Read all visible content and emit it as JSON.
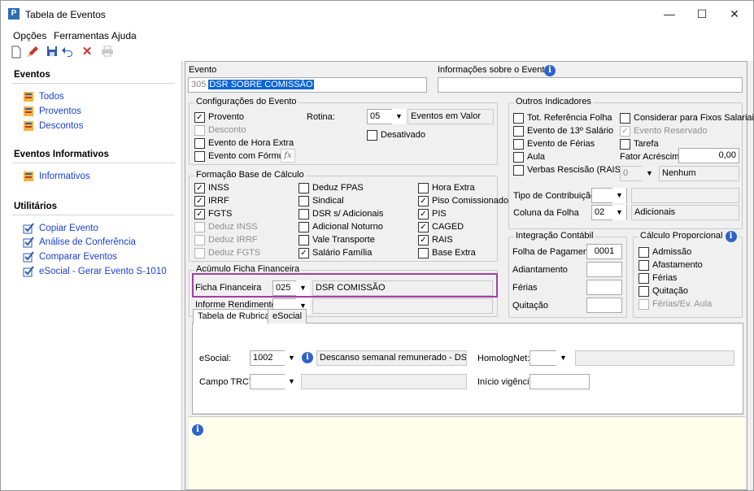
{
  "window": {
    "title": "Tabela de Eventos",
    "minimize": "—",
    "maximize": "☐",
    "close": "✕"
  },
  "menu": [
    "Opções",
    "Ferramentas",
    "Ajuda"
  ],
  "sidebar": {
    "eventos": {
      "heading": "Eventos",
      "items": [
        "Todos",
        "Proventos",
        "Descontos"
      ]
    },
    "informativos": {
      "heading": "Eventos Informativos",
      "items": [
        "Informativos"
      ]
    },
    "utilitarios": {
      "heading": "Utilitários",
      "items": [
        "Copiar Evento",
        "Análise de Conferência",
        "Comparar Eventos",
        "eSocial - Gerar Evento S-1010"
      ]
    }
  },
  "evento": {
    "label": "Evento",
    "code": "305",
    "name": "DSR SOBRE COMISSÃO",
    "info_label": "Informações sobre o Evento",
    "info_value": ""
  },
  "config": {
    "title": "Configurações do Evento",
    "provento": "Provento",
    "desconto": "Desconto",
    "hora_extra": "Evento de Hora Extra",
    "formula": "Evento com Fórmula",
    "rotina_label": "Rotina:",
    "rotina_value": "05",
    "rotina_desc": "Eventos em Valor",
    "desativado": "Desativado",
    "fx": "fx"
  },
  "base": {
    "title": "Formação Base de Cálculo",
    "col1": [
      "INSS",
      "IRRF",
      "FGTS",
      "Deduz INSS",
      "Deduz IRRF",
      "Deduz FGTS"
    ],
    "col2": [
      "Deduz FPAS",
      "Sindical",
      "DSR s/ Adicionais",
      "Adicional Noturno",
      "Vale Transporte",
      "Salário Família"
    ],
    "col3": [
      "Hora Extra",
      "Piso Comissionado",
      "PIS",
      "CAGED",
      "RAIS",
      "Base Extra"
    ]
  },
  "acumulo": {
    "title": "Acúmulo Ficha Financeira",
    "ficha_label": "Ficha Financeira",
    "ficha_code": "025",
    "ficha_desc": "DSR COMISSÃO",
    "informe_label": "Informe Rendimentos",
    "informe_value": ""
  },
  "outros": {
    "title": "Outros Indicadores",
    "left": [
      "Tot. Referência Folha",
      "Evento de 13º Salário",
      "Evento de Férias",
      "Aula",
      "Verbas Rescisão (RAIS)"
    ],
    "right": [
      "Considerar para Fixos Salariais",
      "Evento Reservado",
      "Tarefa"
    ],
    "fator_label": "Fator Acréscimo",
    "fator_value": "0,00",
    "nenhum_code": "0",
    "nenhum_desc": "Nenhum",
    "tipo_contrib_label": "Tipo de Contribuição",
    "tipo_contrib_value": "",
    "coluna_label": "Coluna da Folha",
    "coluna_code": "02",
    "coluna_desc": "Adicionais"
  },
  "integracao": {
    "title": "Integração Contábil",
    "rows": [
      {
        "label": "Folha de Pagamento",
        "value": "0001"
      },
      {
        "label": "Adiantamento",
        "value": ""
      },
      {
        "label": "Férias",
        "value": ""
      },
      {
        "label": "Quitação",
        "value": ""
      }
    ]
  },
  "calculo": {
    "title": "Cálculo Proporcional",
    "items": [
      "Admissão",
      "Afastamento",
      "Férias",
      "Quitação",
      "Férias/Ev. Aula"
    ]
  },
  "tabs": {
    "items": [
      "Tabela de Rubricas",
      "eSocial"
    ],
    "esocial_label": "eSocial:",
    "esocial_code": "1002",
    "esocial_desc": "Descanso semanal remunerado - DSR",
    "homolog_label": "HomologNet:",
    "homolog_value": "",
    "trct_label": "Campo TRCT:",
    "trct_value": "",
    "vigencia_label": "Início vigência:",
    "vigencia_value": ""
  }
}
